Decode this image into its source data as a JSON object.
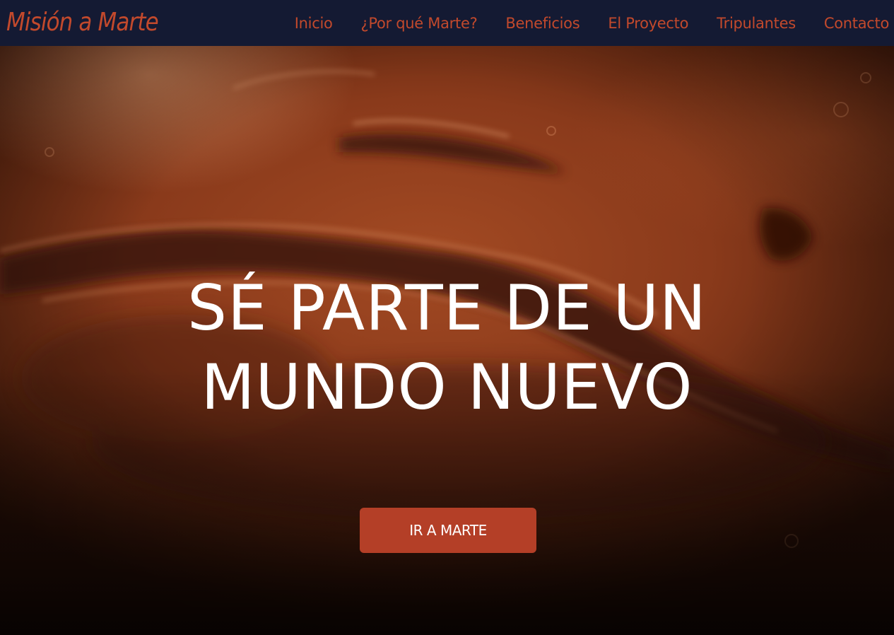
{
  "brand": {
    "name": "Misión a Marte"
  },
  "nav": {
    "items": [
      {
        "label": "Inicio"
      },
      {
        "label": "¿Por qué Marte?"
      },
      {
        "label": "Beneficios"
      },
      {
        "label": "El Proyecto"
      },
      {
        "label": "Tripulantes"
      },
      {
        "label": "Contacto"
      }
    ]
  },
  "hero": {
    "title_line_1": "SÉ PARTE DE UN",
    "title_line_2": "MUNDO NUEVO",
    "cta_label": "IR A MARTE",
    "background": "mars-surface-image"
  },
  "colors": {
    "navbar_bg": "#141a33",
    "accent": "#c2492c",
    "button_bg": "#b43f27",
    "hero_text": "#ffffff"
  }
}
